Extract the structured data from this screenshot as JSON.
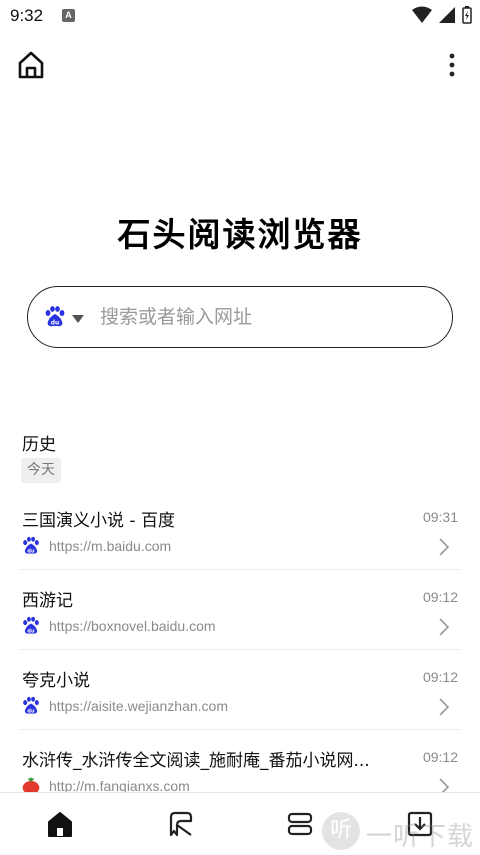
{
  "status_bar": {
    "time": "9:32",
    "notification_glyph": "A",
    "icons": [
      "wifi-icon",
      "signal-icon",
      "battery-icon"
    ]
  },
  "top_bar": {
    "home_icon": "home-icon",
    "menu_icon": "more-vert-icon"
  },
  "brand_title": "石头阅读浏览器",
  "search": {
    "engine_icon": "baidu-icon",
    "placeholder": "搜索或者输入网址"
  },
  "history": {
    "title": "历史",
    "day_label": "今天",
    "items": [
      {
        "title": "三国演义小说 - 百度",
        "time": "09:31",
        "url": "https://m.baidu.com",
        "favicon": "baidu-icon"
      },
      {
        "title": "西游记",
        "time": "09:12",
        "url": "https://boxnovel.baidu.com",
        "favicon": "baidu-icon"
      },
      {
        "title": "夸克小说",
        "time": "09:12",
        "url": "https://aisite.wejianzhan.com",
        "favicon": "baidu-icon"
      },
      {
        "title": "水浒传_水浒传全文阅读_施耐庵_番茄小说网...",
        "time": "09:12",
        "url": "http://m.fanqianxs.com",
        "favicon": "tomato-icon"
      }
    ]
  },
  "bottom_nav": {
    "items": [
      "home-icon",
      "bookmark-icon",
      "tabs-icon",
      "download-icon"
    ]
  },
  "watermark": {
    "glyph": "听",
    "text": "一听下载"
  },
  "colors": {
    "baidu_blue": "#2932e1",
    "tomato_red": "#e23a2e",
    "text_primary": "#111111",
    "text_secondary": "#8a8a8a"
  }
}
